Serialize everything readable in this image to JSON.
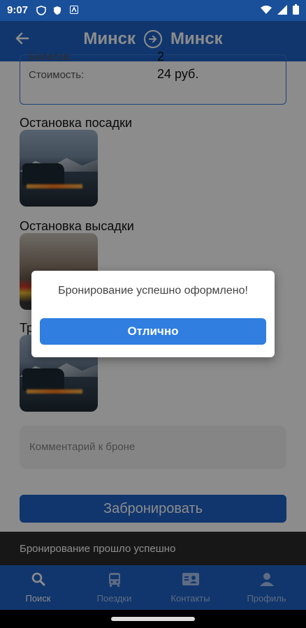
{
  "status_bar": {
    "time": "9:07"
  },
  "app_bar": {
    "back_icon": "arrow-left-icon",
    "from": "Минск",
    "to": "Минск",
    "route_icon": "arrow-right-circle-icon"
  },
  "info_card": {
    "tickets_label": "Билетов:",
    "tickets_value": "2",
    "cost_label": "Стоимость:",
    "cost_value": "24 руб."
  },
  "sections": {
    "boarding_title": "Остановка посадки",
    "dropoff_title": "Остановка высадки",
    "transport_title": "Тр"
  },
  "comment": {
    "placeholder": "Комментарий к броне"
  },
  "book_button": {
    "label": "Забронировать"
  },
  "snackbar": {
    "text": "Бронирование прошло успешно"
  },
  "bottom_nav": {
    "items": [
      {
        "label": "Поиск",
        "icon": "search-icon"
      },
      {
        "label": "Поездки",
        "icon": "bus-icon"
      },
      {
        "label": "Контакты",
        "icon": "contact-card-icon"
      },
      {
        "label": "Профиль",
        "icon": "person-icon"
      }
    ]
  },
  "dialog": {
    "message": "Бронирование успешно оформлено!",
    "ok_label": "Отлично"
  },
  "colors": {
    "primary": "#1f63c7",
    "status_bar": "#1a4f99",
    "dialog_button": "#2f7ee0",
    "snackbar": "#2b2b2b"
  }
}
